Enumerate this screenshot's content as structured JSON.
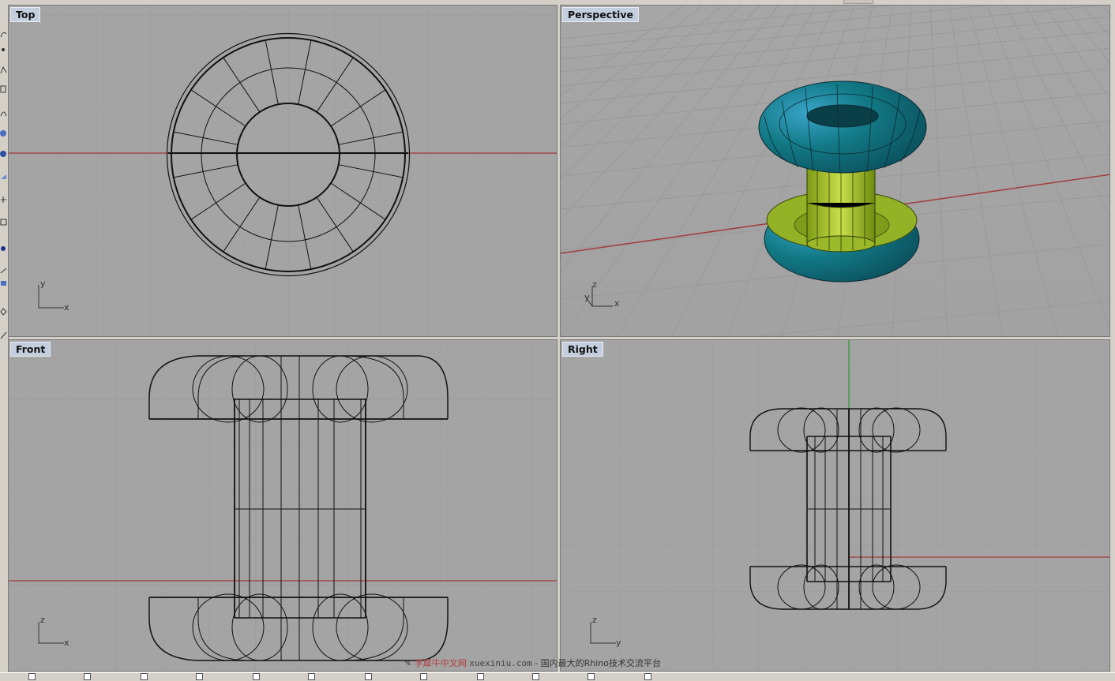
{
  "viewports": {
    "top": {
      "label": "Top",
      "axis_h": "x",
      "axis_v": "y"
    },
    "perspective": {
      "label": "Perspective",
      "axis_x": "x",
      "axis_y": "y",
      "axis_z": "z"
    },
    "front": {
      "label": "Front",
      "axis_h": "x",
      "axis_v": "z"
    },
    "right": {
      "label": "Right",
      "axis_h": "y",
      "axis_v": "z"
    }
  },
  "watermark": {
    "logo": "学犀牛中文网",
    "site": "xuexiniu.com",
    "tagline": "- 国内最大的Rhino技术交流平台"
  },
  "colors": {
    "viewport_bg": "#a4a4a4",
    "grid": "#9a9a9a",
    "x_axis": "#a33b3b",
    "y_axis": "#2f9a2f",
    "label_bg": "#c3cfde",
    "torus_teal": "#12707c",
    "cylinder_yellow": "#a8c428"
  }
}
